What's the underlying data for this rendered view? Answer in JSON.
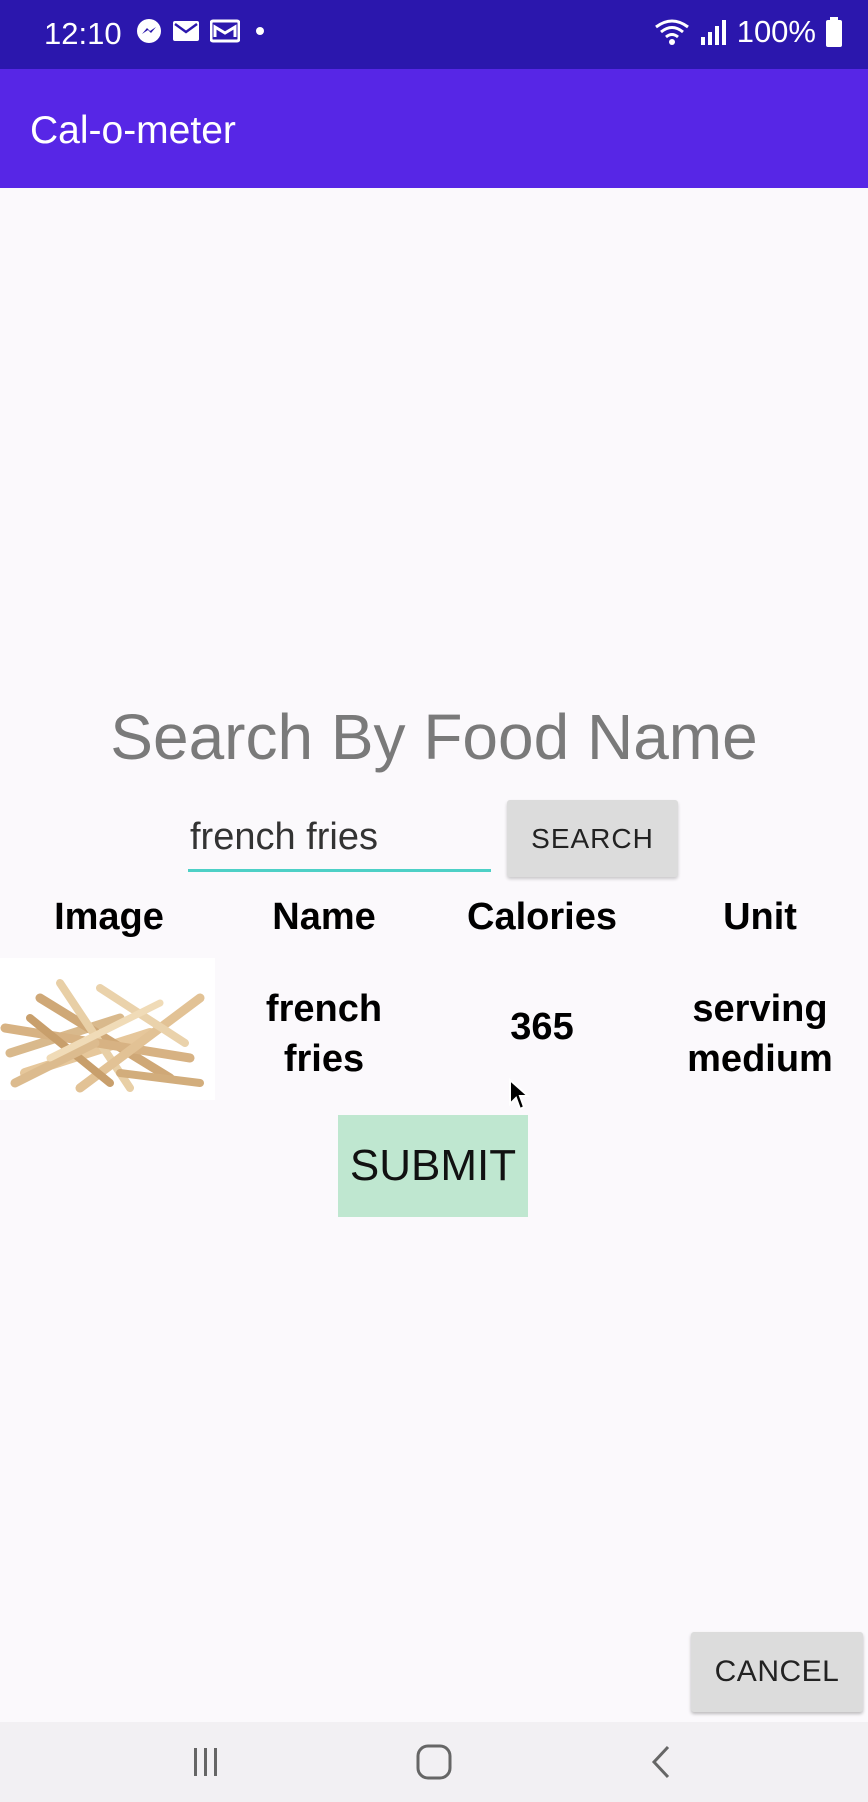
{
  "status_bar": {
    "time": "12:10",
    "battery": "100%",
    "notification_icons": [
      "messenger-icon",
      "mail-icon",
      "gmail-icon",
      "dot-icon"
    ],
    "system_icons": [
      "wifi-icon",
      "signal-icon",
      "battery-icon"
    ]
  },
  "app_bar": {
    "title": "Cal-o-meter"
  },
  "main": {
    "heading": "Search By Food Name",
    "search": {
      "value": "french fries",
      "button_label": "SEARCH"
    },
    "table": {
      "headers": [
        "Image",
        "Name",
        "Calories",
        "Unit"
      ],
      "rows": [
        {
          "image_icon": "french-fries-image",
          "name_line1": "french",
          "name_line2": "fries",
          "calories": "365",
          "unit_line1": "serving",
          "unit_line2": "medium"
        }
      ]
    },
    "submit_label": "SUBMIT",
    "cancel_label": "CANCEL"
  },
  "nav_bar": {
    "icons": [
      "recents-icon",
      "home-icon",
      "back-icon"
    ]
  },
  "colors": {
    "status_bar": "#2b17ad",
    "app_bar": "#5726e6",
    "input_underline": "#4dd0c6",
    "submit_bg": "#bfe7d0"
  }
}
